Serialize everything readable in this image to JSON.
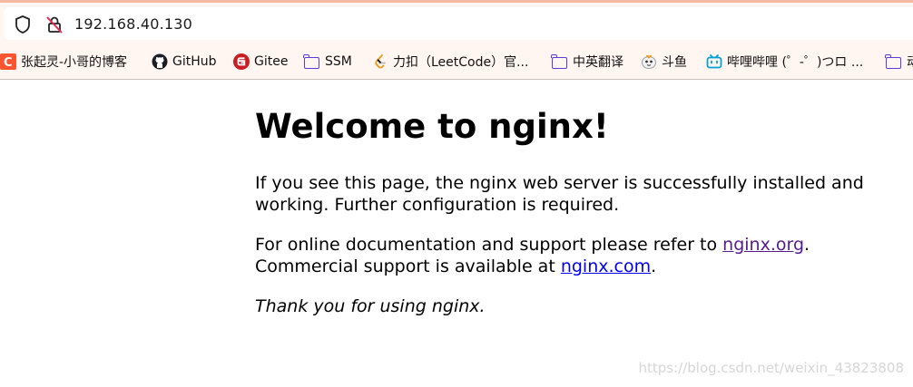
{
  "browser": {
    "url": "192.168.40.130",
    "icons": {
      "security": "shield-icon",
      "insecure": "lock-slash-icon"
    },
    "bookmarks": [
      {
        "label": "张起灵-小哥的博客",
        "icon": "csdn-icon"
      },
      {
        "label": "GitHub",
        "icon": "github-icon"
      },
      {
        "label": "Gitee",
        "icon": "gitee-icon"
      },
      {
        "label": "SSM",
        "icon": "folder-icon"
      },
      {
        "label": "力扣（LeetCode）官...",
        "icon": "leetcode-icon"
      },
      {
        "label": "中英翻译",
        "icon": "folder-icon"
      },
      {
        "label": "斗鱼",
        "icon": "douyu-icon"
      },
      {
        "label": "哔哩哔哩 (゜-゜)つロ ...",
        "icon": "bilibili-icon"
      },
      {
        "label": "动",
        "icon": "folder-icon"
      }
    ]
  },
  "page": {
    "title": "Welcome to nginx!",
    "para1": "If you see this page, the nginx web server is successfully installed and working. Further configuration is required.",
    "para1_line1": "If you see this page, the nginx web server is successfully installed and",
    "para1_line2": "working. Further configuration is required.",
    "para2_prefix": "For online documentation and support please refer to ",
    "link_org": "nginx.org",
    "para2_mid": ".",
    "para2_line2_prefix": "Commercial support is available at ",
    "link_com": "nginx.com",
    "para2_suffix": ".",
    "thanks": "Thank you for using nginx."
  },
  "watermark": "https://blog.csdn.net/weixin_43823808",
  "colors": {
    "link": "#0000ee",
    "visited_link": "#551a8b",
    "chrome_bg": "#fff6f1",
    "folder": "#5b3bd6"
  }
}
